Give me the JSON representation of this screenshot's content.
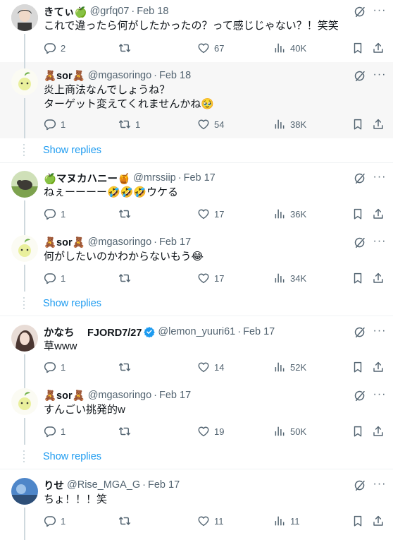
{
  "replies": [
    {
      "name": "きてぃ🍏",
      "handle": "@grfq07",
      "date": "Feb 18",
      "text": "これで違ったら何がしたかったの？って感じじゃない？！笑笑",
      "reply_count": "2",
      "retweet_count": "",
      "like_count": "67",
      "view_count": "40K"
    },
    {
      "name": "🧸sor🧸",
      "handle": "@mgasoringo",
      "date": "Feb 18",
      "text_line1": "炎上商法なんでしょうね？",
      "text_line2": "ターゲット変えてくれませんかね🥹",
      "reply_count": "1",
      "retweet_count": "1",
      "like_count": "54",
      "view_count": "38K"
    },
    {
      "name": "🍏マヌカハニー🍯",
      "handle": "@mrssiip",
      "date": "Feb 17",
      "text": "ねぇーーーー🤣🤣🤣ウケる",
      "reply_count": "1",
      "retweet_count": "",
      "like_count": "17",
      "view_count": "36K"
    },
    {
      "name": "🧸sor🧸",
      "handle": "@mgasoringo",
      "date": "Feb 17",
      "text": "何がしたいのかわからないもう😂",
      "reply_count": "1",
      "retweet_count": "",
      "like_count": "17",
      "view_count": "34K"
    },
    {
      "name": "かなち　 FJORD7/27",
      "handle": "@lemon_yuuri61",
      "date": "Feb 17",
      "text": "草www",
      "reply_count": "1",
      "retweet_count": "",
      "like_count": "14",
      "view_count": "52K"
    },
    {
      "name": "🧸sor🧸",
      "handle": "@mgasoringo",
      "date": "Feb 17",
      "text": "すんごい挑発的w",
      "reply_count": "1",
      "retweet_count": "",
      "like_count": "19",
      "view_count": "50K"
    },
    {
      "name": "りせ",
      "handle": "@Rise_MGA_G",
      "date": "Feb 17",
      "text": "ちょ！！！笑",
      "reply_count": "1",
      "retweet_count": "",
      "like_count": "11",
      "view_count": "11"
    }
  ],
  "show_replies_label": "Show replies",
  "dot": "·",
  "colors": {
    "accent": "#1d9bf0",
    "secondary_text": "#536471",
    "thread_line": "#cfd9de",
    "highlight_bg": "#f7f7f7"
  },
  "icons": [
    "reply-icon",
    "retweet-icon",
    "like-icon",
    "views-icon",
    "bookmark-icon",
    "share-icon",
    "grok-icon",
    "more-icon",
    "verified-icon"
  ]
}
